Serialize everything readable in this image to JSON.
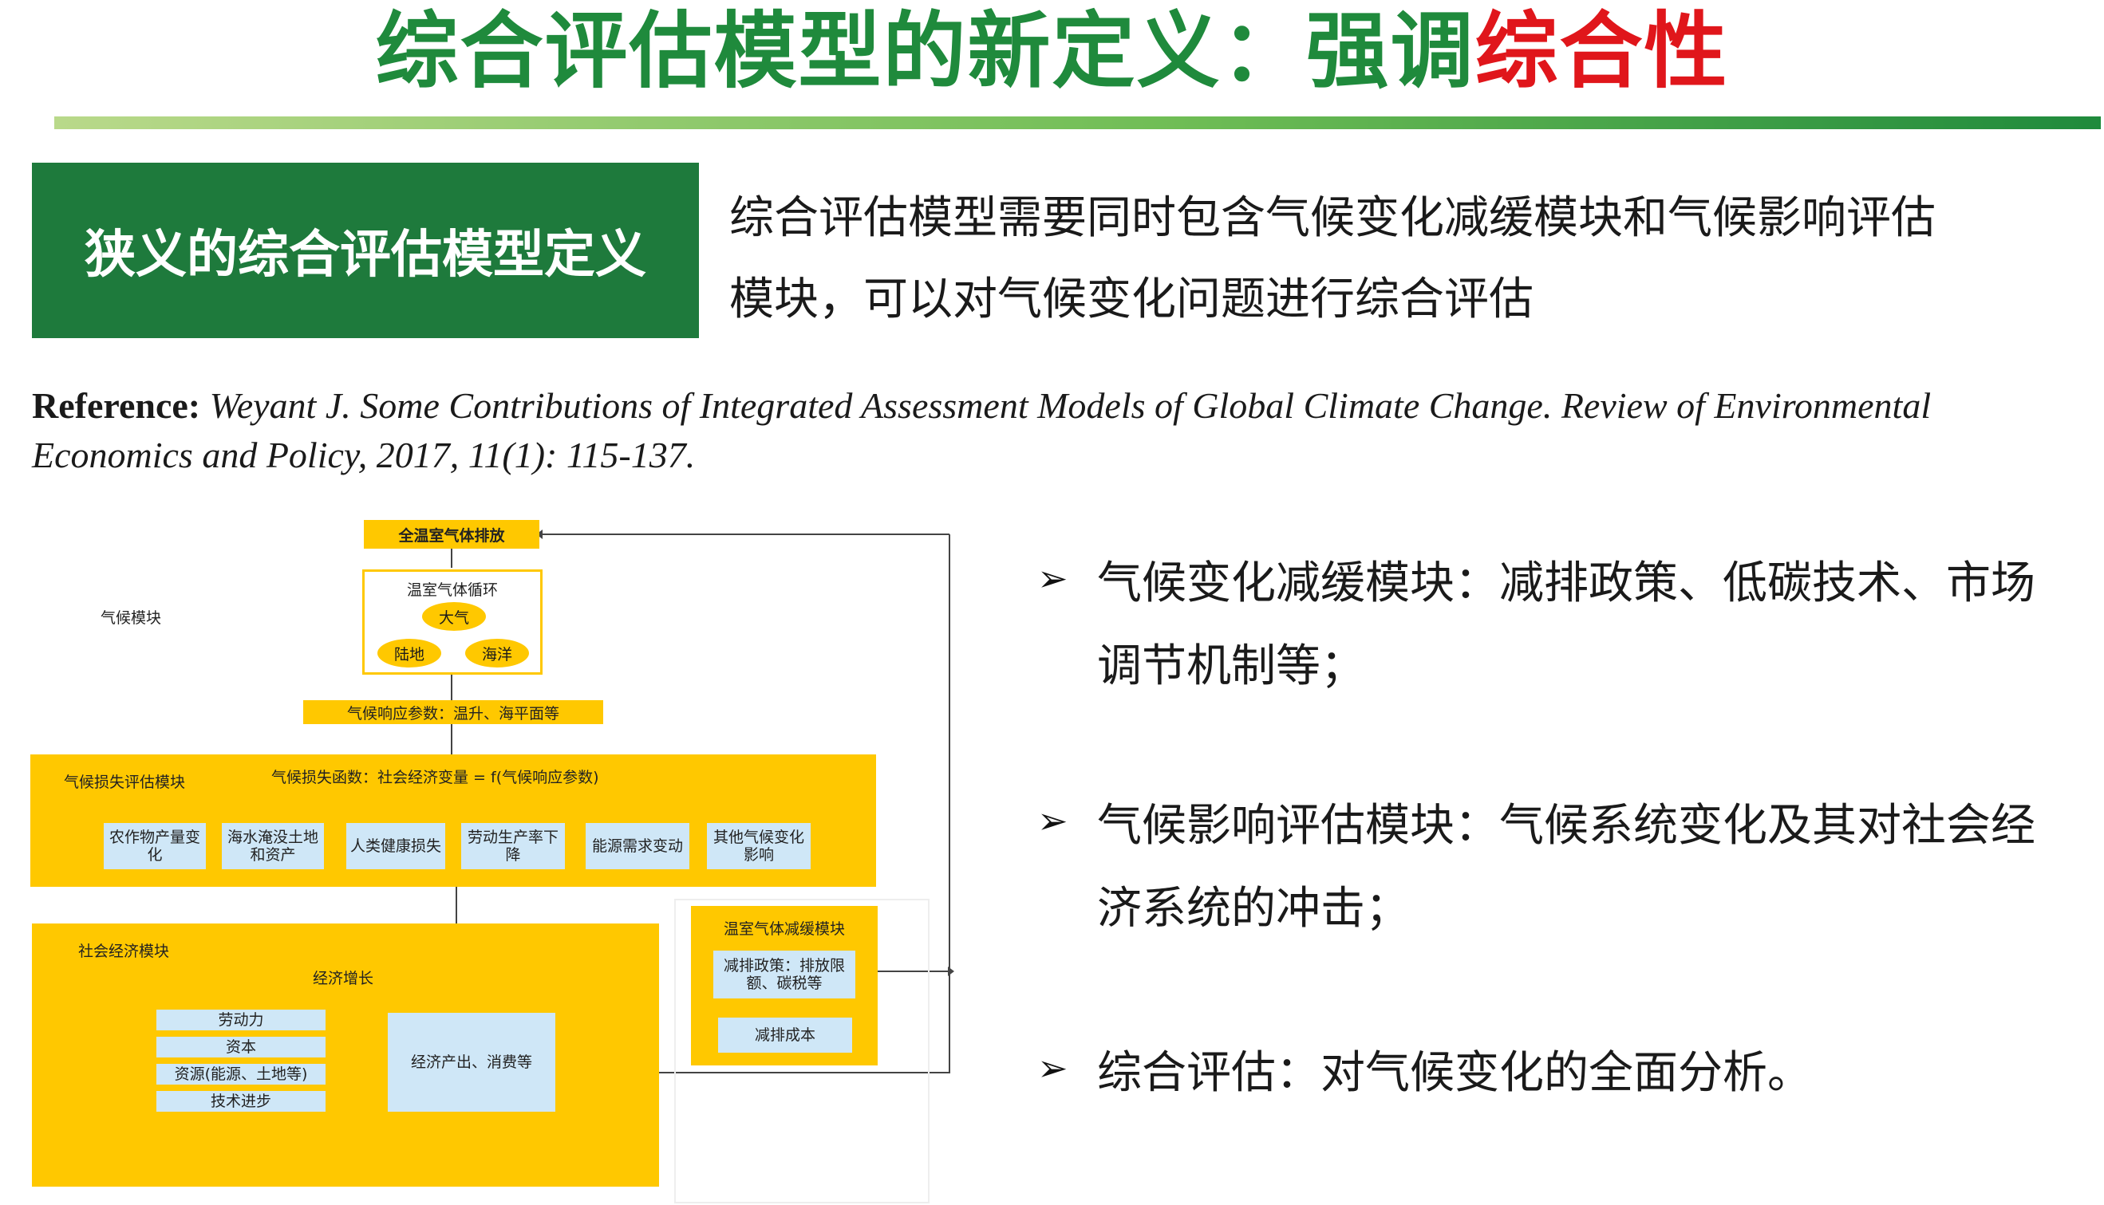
{
  "title": {
    "main": "综合评估模型的新定义：强调",
    "highlight": "综合性"
  },
  "definition": {
    "box_label": "狭义的综合评估模型定义",
    "line1": "综合评估模型需要同时包含气候变化减缓模块和气候影响评估",
    "line2": "模块，可以对气候变化问题进行综合评估"
  },
  "reference": {
    "label": "Reference:",
    "text": " Weyant J. Some Contributions of Integrated Assessment Models of Global Climate Change. Review of Environmental Economics and Policy, 2017, 11(1): 115-137."
  },
  "bullets": [
    {
      "arrow": "➢",
      "line1": "气候变化减缓模块：减排政策、低碳技术、市场",
      "line2": "调节机制等；"
    },
    {
      "arrow": "➢",
      "line1": "气候影响评估模块：气候系统变化及其对社会经",
      "line2": "济系统的冲击；"
    },
    {
      "arrow": "➢",
      "line1": "综合评估：对气候变化的全面分析。",
      "line2": ""
    }
  ],
  "diagram": {
    "ghg_emission": "全温室气体排放",
    "ghg_cycle": "温室气体循环",
    "atmosphere": "大气",
    "land": "陆地",
    "ocean": "海洋",
    "climate_module": "气候模块",
    "climate_params": "气候响应参数：温升、海平面等",
    "damage_module": "气候损失评估模块",
    "damage_function": "气候损失函数：社会经济变量 = f(气候响应参数)",
    "impacts": [
      "农作物产量变化",
      "海水淹没土地和资产",
      "人类健康损失",
      "劳动生产率下降",
      "能源需求变动",
      "其他气候变化影响"
    ],
    "socio_module": "社会经济模块",
    "econ_growth": "经济增长",
    "inputs": [
      "劳动力",
      "资本",
      "资源(能源、土地等)",
      "技术进步"
    ],
    "output": "经济产出、消费等",
    "mitigation_module": "温室气体减缓模块",
    "mitigation_policy": "减排政策：排放限额、碳税等",
    "abatement_cost": "减排成本"
  },
  "colors": {
    "title_green": "#1f8a3c",
    "title_red": "#e0161b",
    "box_green": "#1e7a3c",
    "diagram_yellow": "#ffc800",
    "diagram_blue": "#cfe7f7",
    "arrow_blue": "#2e75d6"
  }
}
